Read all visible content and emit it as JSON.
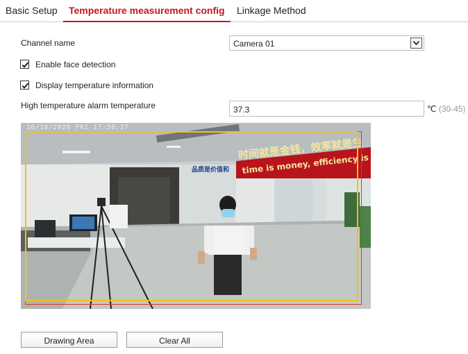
{
  "tabs": [
    {
      "label": "Basic Setup",
      "active": false
    },
    {
      "label": "Temperature measurement config",
      "active": true
    },
    {
      "label": "Linkage Method",
      "active": false
    }
  ],
  "form": {
    "channel_label": "Channel name",
    "channel_value": "Camera 01",
    "face_detection_label": "Enable face detection",
    "face_detection_checked": true,
    "display_temp_label": "Display temperature information",
    "display_temp_checked": true,
    "alarm_temp_label": "High temperature alarm temperature",
    "alarm_temp_value": "37.3",
    "alarm_temp_unit": "℃",
    "alarm_temp_range": "(30-45)"
  },
  "preview": {
    "osd_timestamp": "16/10/2020 FRI 17:30:37",
    "banner_cn": "时间就是金钱，效率就是生",
    "banner_en": "time is money, efficiency is",
    "wall_sign": "品质是价值和",
    "area_colors": {
      "yellow": "#f2c019",
      "red": "#d23a2a"
    }
  },
  "buttons": {
    "drawing_area": "Drawing Area",
    "clear_all": "Clear All"
  },
  "colors": {
    "accent": "#c5161d"
  }
}
